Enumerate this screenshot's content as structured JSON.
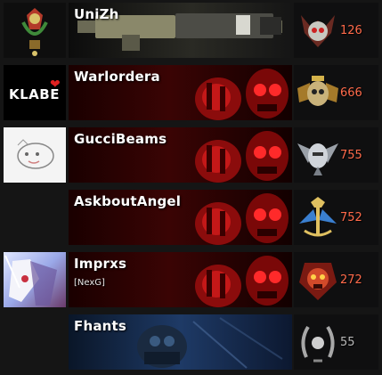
{
  "players": [
    {
      "name": "UniZh",
      "tag": "",
      "rank": "126",
      "avatar": "crest-icon",
      "card": "rifle-calling-card",
      "emblem": "horned-skull-emblem",
      "rank_color": "#ff6a4a"
    },
    {
      "name": "Warlordera",
      "tag": "",
      "rank": "666",
      "avatar": "klabe-logo",
      "avatar_text": "KLABE",
      "card": "red-skull-calling-card",
      "emblem": "winged-skull-emblem",
      "rank_color": "#ff6a4a"
    },
    {
      "name": "GucciBeams",
      "tag": "",
      "rank": "755",
      "avatar": "sketch-avatar",
      "card": "red-skull-calling-card",
      "emblem": "winged-helmet-emblem",
      "rank_color": "#ff6a4a"
    },
    {
      "name": "AskboutAngel",
      "tag": "",
      "rank": "752",
      "avatar": "blank-avatar",
      "card": "red-skull-calling-card",
      "emblem": "trident-wing-emblem",
      "rank_color": "#ff6a4a"
    },
    {
      "name": "Imprxs",
      "tag": "[NexG]",
      "rank": "272",
      "avatar": "anime-avatar",
      "card": "red-skull-calling-card",
      "emblem": "red-skull-emblem",
      "rank_color": "#ff6a4a"
    },
    {
      "name": "Fhants",
      "tag": "",
      "rank": "55",
      "avatar": "blank-avatar",
      "card": "blue-soldier-calling-card",
      "emblem": "laurel-wreath-emblem",
      "rank_color": "#b8b8b8"
    }
  ]
}
